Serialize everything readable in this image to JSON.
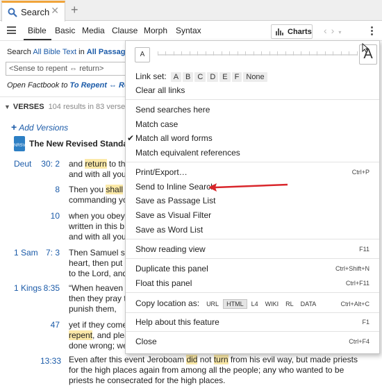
{
  "tab": {
    "label": "Search",
    "search_icon": "magnifier-icon",
    "close": "✕",
    "add": "+"
  },
  "toolbar": {
    "tabs": [
      "Bible",
      "Basic",
      "Media",
      "Clause",
      "Morph",
      "Syntax"
    ],
    "charts_label": "Charts"
  },
  "search": {
    "prefix": "Search",
    "scope": "All Bible Text",
    "in": "in",
    "range": "All Passages",
    "query": "<Sense to repent ⇔ return>",
    "factbook_prefix": "Open Factbook to",
    "factbook_target": "To Repent ⇔ Re"
  },
  "verses": {
    "title": "VERSES",
    "count": "104 results in 83 verses",
    "add_versions": "Add Versions",
    "version_title": "The New Revised Standard"
  },
  "results": [
    {
      "ref": "Deut",
      "cv": "30:  2",
      "lines": [
        "and |return| to th",
        "and with all you"
      ]
    },
    {
      "ref": "",
      "cv": "8",
      "lines": [
        "Then you |shall| a",
        "commanding yo"
      ]
    },
    {
      "ref": "",
      "cv": "10",
      "lines": [
        "when you obey",
        "written in this b",
        "and with all you"
      ]
    },
    {
      "ref": "1 Sam",
      "cv": "7:  3",
      "lines": [
        "Then Samuel sa",
        "heart, then put",
        "to the Lord, and"
      ]
    },
    {
      "ref": "1 Kings",
      "cv": "8:35",
      "lines": [
        "“When heaven i",
        "then they pray t",
        "punish them,"
      ]
    },
    {
      "ref": "",
      "cv": "47",
      "lines": [
        "yet if they come",
        "|repent|, and plea",
        "done wrong; we"
      ]
    }
  ],
  "bottom_verse": {
    "cv": "13:33",
    "text_a": "Even after this event Jeroboam ",
    "hl1": "did",
    "text_b": " not ",
    "hl2": "turn",
    "text_c": " from his evil way, but made priests for the high places again from among all the people; any who wanted to be priests he consecrated for the high places."
  },
  "menu": {
    "font_small": "A",
    "font_large": "A",
    "link_set_label": "Link set:",
    "link_sets": [
      "A",
      "B",
      "C",
      "D",
      "E",
      "F",
      "None"
    ],
    "clear_links": "Clear all links",
    "send_searches": "Send searches here",
    "match_case": "Match case",
    "match_word_forms": "Match all word forms",
    "match_equiv": "Match equivalent references",
    "print_export": "Print/Export…",
    "print_shortcut": "Ctrl+P",
    "send_inline": "Send to Inline Search",
    "save_passage": "Save as Passage List",
    "save_visual": "Save as Visual Filter",
    "save_word": "Save as Word List",
    "show_reading": "Show reading view",
    "show_reading_shortcut": "F11",
    "duplicate": "Duplicate this panel",
    "duplicate_shortcut": "Ctrl+Shift+N",
    "float": "Float this panel",
    "float_shortcut": "Ctrl+F11",
    "copy_location": "Copy location as:",
    "formats": [
      "URL",
      "HTML",
      "L4",
      "WIKI",
      "RL",
      "DATA"
    ],
    "copy_shortcut": "Ctrl+Alt+C",
    "help": "Help about this feature",
    "help_shortcut": "F1",
    "close": "Close",
    "close_shortcut": "Ctrl+F4"
  },
  "colors": {
    "accent_tab": "#f0a43a",
    "link_blue": "#1a5aa8",
    "highlight": "#fbe9a8",
    "arrow_red": "#d9262b"
  }
}
